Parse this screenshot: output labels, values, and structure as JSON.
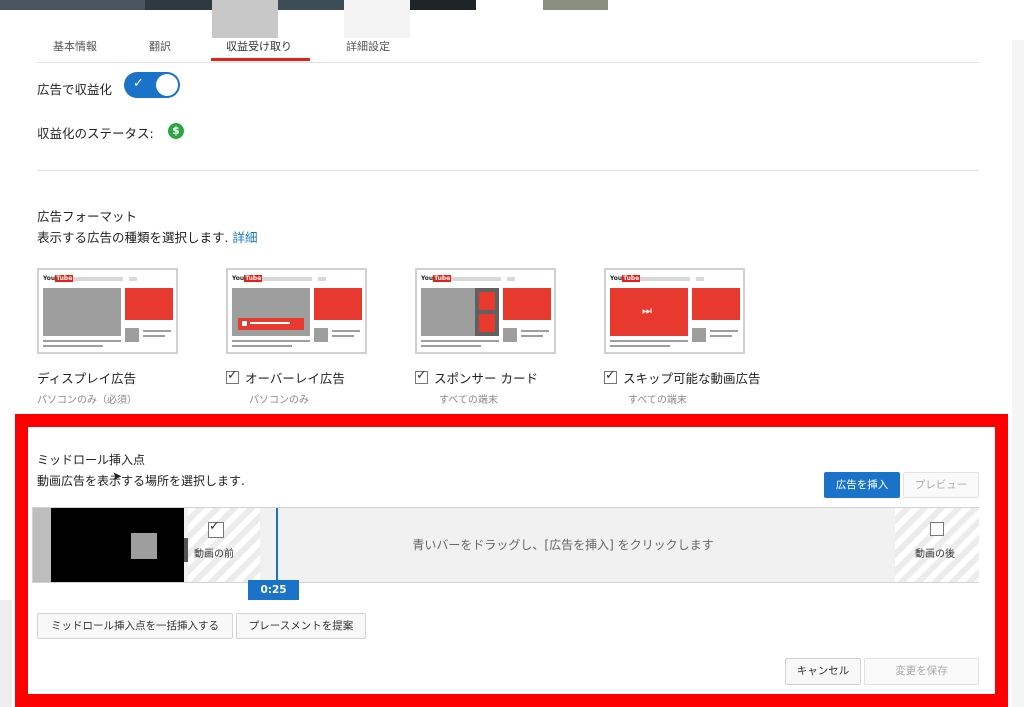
{
  "tabs": [
    "基本情報",
    "翻訳",
    "収益受け取り",
    "詳細設定"
  ],
  "monetization": {
    "ads_label": "広告で収益化",
    "toggle_on": true,
    "status_label": "収益化のステータス:",
    "status_icon": "dollar-icon",
    "status_color": "#2ba640"
  },
  "ad_formats": {
    "title": "広告フォーマット",
    "description": "表示する広告の種類を選択します.",
    "details_link": "詳細",
    "items": [
      {
        "name": "ディスプレイ広告",
        "sub": "パソコンのみ（必須）",
        "checked": null
      },
      {
        "name": "オーバーレイ広告",
        "sub": "パソコンのみ",
        "checked": true
      },
      {
        "name": "スポンサー カード",
        "sub": "すべての端末",
        "checked": true
      },
      {
        "name": "スキップ可能な動画広告",
        "sub": "すべての端末",
        "checked": true
      }
    ]
  },
  "midroll": {
    "title": "ミッドロール挿入点",
    "description": "動画広告を表示する場所を選択します.",
    "insert_button": "広告を挿入",
    "preview_button": "プレビュー",
    "timeline_hint": "青いバーをドラッグし、[広告を挿入] をクリックします",
    "before_video": "動画の前",
    "before_checked": true,
    "after_video": "動画の後",
    "after_checked": false,
    "time": "0:25",
    "bulk_insert_button": "ミッドロール挿入点を一括挿入する",
    "suggest_button": "プレースメントを提案",
    "cancel_button": "キャンセル",
    "save_button": "変更を保存"
  },
  "colors": {
    "accent": "#1a73c8",
    "highlight_frame": "#ff0000",
    "brand_red": "#e62117"
  }
}
